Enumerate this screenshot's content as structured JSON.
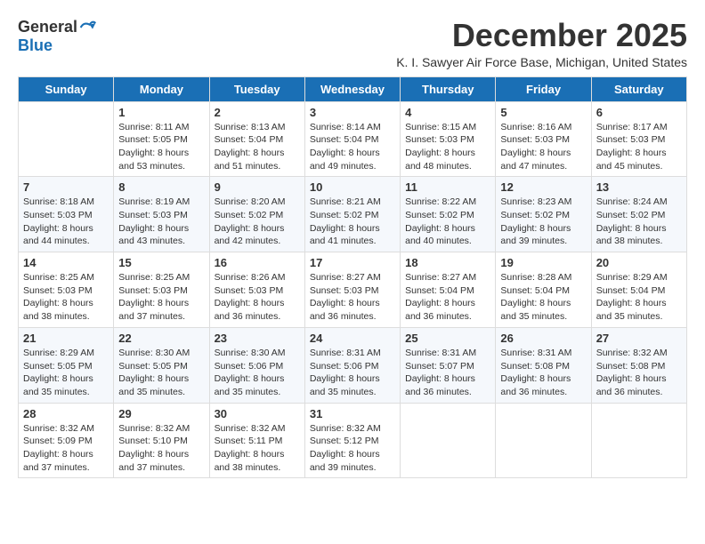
{
  "logo": {
    "general": "General",
    "blue": "Blue"
  },
  "header": {
    "title": "December 2025",
    "subtitle": "K. I. Sawyer Air Force Base, Michigan, United States"
  },
  "days_of_week": [
    "Sunday",
    "Monday",
    "Tuesday",
    "Wednesday",
    "Thursday",
    "Friday",
    "Saturday"
  ],
  "weeks": [
    [
      {
        "day": "",
        "info": ""
      },
      {
        "day": "1",
        "info": "Sunrise: 8:11 AM\nSunset: 5:05 PM\nDaylight: 8 hours\nand 53 minutes."
      },
      {
        "day": "2",
        "info": "Sunrise: 8:13 AM\nSunset: 5:04 PM\nDaylight: 8 hours\nand 51 minutes."
      },
      {
        "day": "3",
        "info": "Sunrise: 8:14 AM\nSunset: 5:04 PM\nDaylight: 8 hours\nand 49 minutes."
      },
      {
        "day": "4",
        "info": "Sunrise: 8:15 AM\nSunset: 5:03 PM\nDaylight: 8 hours\nand 48 minutes."
      },
      {
        "day": "5",
        "info": "Sunrise: 8:16 AM\nSunset: 5:03 PM\nDaylight: 8 hours\nand 47 minutes."
      },
      {
        "day": "6",
        "info": "Sunrise: 8:17 AM\nSunset: 5:03 PM\nDaylight: 8 hours\nand 45 minutes."
      }
    ],
    [
      {
        "day": "7",
        "info": "Sunrise: 8:18 AM\nSunset: 5:03 PM\nDaylight: 8 hours\nand 44 minutes."
      },
      {
        "day": "8",
        "info": "Sunrise: 8:19 AM\nSunset: 5:03 PM\nDaylight: 8 hours\nand 43 minutes."
      },
      {
        "day": "9",
        "info": "Sunrise: 8:20 AM\nSunset: 5:02 PM\nDaylight: 8 hours\nand 42 minutes."
      },
      {
        "day": "10",
        "info": "Sunrise: 8:21 AM\nSunset: 5:02 PM\nDaylight: 8 hours\nand 41 minutes."
      },
      {
        "day": "11",
        "info": "Sunrise: 8:22 AM\nSunset: 5:02 PM\nDaylight: 8 hours\nand 40 minutes."
      },
      {
        "day": "12",
        "info": "Sunrise: 8:23 AM\nSunset: 5:02 PM\nDaylight: 8 hours\nand 39 minutes."
      },
      {
        "day": "13",
        "info": "Sunrise: 8:24 AM\nSunset: 5:02 PM\nDaylight: 8 hours\nand 38 minutes."
      }
    ],
    [
      {
        "day": "14",
        "info": "Sunrise: 8:25 AM\nSunset: 5:03 PM\nDaylight: 8 hours\nand 38 minutes."
      },
      {
        "day": "15",
        "info": "Sunrise: 8:25 AM\nSunset: 5:03 PM\nDaylight: 8 hours\nand 37 minutes."
      },
      {
        "day": "16",
        "info": "Sunrise: 8:26 AM\nSunset: 5:03 PM\nDaylight: 8 hours\nand 36 minutes."
      },
      {
        "day": "17",
        "info": "Sunrise: 8:27 AM\nSunset: 5:03 PM\nDaylight: 8 hours\nand 36 minutes."
      },
      {
        "day": "18",
        "info": "Sunrise: 8:27 AM\nSunset: 5:04 PM\nDaylight: 8 hours\nand 36 minutes."
      },
      {
        "day": "19",
        "info": "Sunrise: 8:28 AM\nSunset: 5:04 PM\nDaylight: 8 hours\nand 35 minutes."
      },
      {
        "day": "20",
        "info": "Sunrise: 8:29 AM\nSunset: 5:04 PM\nDaylight: 8 hours\nand 35 minutes."
      }
    ],
    [
      {
        "day": "21",
        "info": "Sunrise: 8:29 AM\nSunset: 5:05 PM\nDaylight: 8 hours\nand 35 minutes."
      },
      {
        "day": "22",
        "info": "Sunrise: 8:30 AM\nSunset: 5:05 PM\nDaylight: 8 hours\nand 35 minutes."
      },
      {
        "day": "23",
        "info": "Sunrise: 8:30 AM\nSunset: 5:06 PM\nDaylight: 8 hours\nand 35 minutes."
      },
      {
        "day": "24",
        "info": "Sunrise: 8:31 AM\nSunset: 5:06 PM\nDaylight: 8 hours\nand 35 minutes."
      },
      {
        "day": "25",
        "info": "Sunrise: 8:31 AM\nSunset: 5:07 PM\nDaylight: 8 hours\nand 36 minutes."
      },
      {
        "day": "26",
        "info": "Sunrise: 8:31 AM\nSunset: 5:08 PM\nDaylight: 8 hours\nand 36 minutes."
      },
      {
        "day": "27",
        "info": "Sunrise: 8:32 AM\nSunset: 5:08 PM\nDaylight: 8 hours\nand 36 minutes."
      }
    ],
    [
      {
        "day": "28",
        "info": "Sunrise: 8:32 AM\nSunset: 5:09 PM\nDaylight: 8 hours\nand 37 minutes."
      },
      {
        "day": "29",
        "info": "Sunrise: 8:32 AM\nSunset: 5:10 PM\nDaylight: 8 hours\nand 37 minutes."
      },
      {
        "day": "30",
        "info": "Sunrise: 8:32 AM\nSunset: 5:11 PM\nDaylight: 8 hours\nand 38 minutes."
      },
      {
        "day": "31",
        "info": "Sunrise: 8:32 AM\nSunset: 5:12 PM\nDaylight: 8 hours\nand 39 minutes."
      },
      {
        "day": "",
        "info": ""
      },
      {
        "day": "",
        "info": ""
      },
      {
        "day": "",
        "info": ""
      }
    ]
  ]
}
